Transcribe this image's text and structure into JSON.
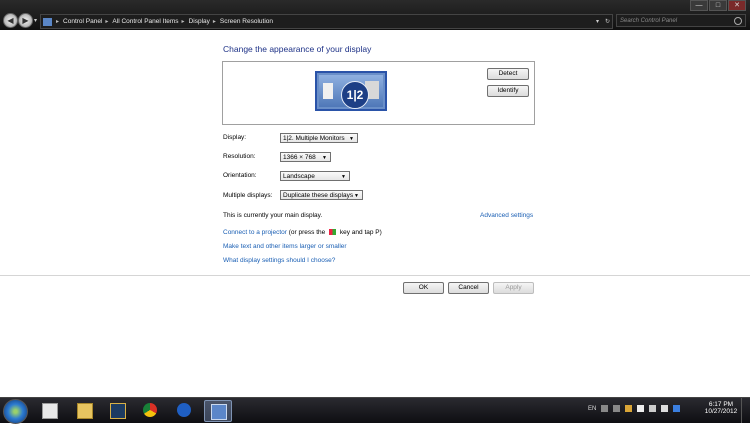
{
  "window": {
    "minimize_label": "—",
    "maximize_label": "□",
    "close_label": "✕"
  },
  "nav": {
    "back_glyph": "◀",
    "forward_glyph": "▶",
    "dropdown_glyph": "▾"
  },
  "breadcrumb": {
    "items": [
      "Control Panel",
      "All Control Panel Items",
      "Display",
      "Screen Resolution"
    ],
    "separator": "▸",
    "history_glyph": "▾",
    "refresh_glyph": "↻"
  },
  "search": {
    "placeholder": "Search Control Panel"
  },
  "page": {
    "title": "Change the appearance of your display",
    "monitor_label": "1|2",
    "detect_label": "Detect",
    "identify_label": "Identify",
    "display_label": "Display:",
    "display_value": "1|2. Multiple Monitors",
    "resolution_label": "Resolution:",
    "resolution_value": "1366 × 768",
    "orientation_label": "Orientation:",
    "orientation_value": "Landscape",
    "multiple_label": "Multiple displays:",
    "multiple_value": "Duplicate these displays",
    "dropdown_glyph": "▼",
    "main_display_text": "This is currently your main display.",
    "advanced_link": "Advanced settings",
    "projector_link": "Connect to a projector",
    "projector_text": "(or press the",
    "projector_text2": "key and tap P)",
    "text_size_link": "Make text and other items larger or smaller",
    "help_link": "What display settings should I choose?",
    "ok_label": "OK",
    "cancel_label": "Cancel",
    "apply_label": "Apply"
  },
  "tray": {
    "language": "EN",
    "time": "6:17 PM",
    "date": "10/27/2012"
  },
  "colors": {
    "link": "#1a5fb4",
    "heading": "#1e3287",
    "chrome": "#1a1a1a"
  }
}
